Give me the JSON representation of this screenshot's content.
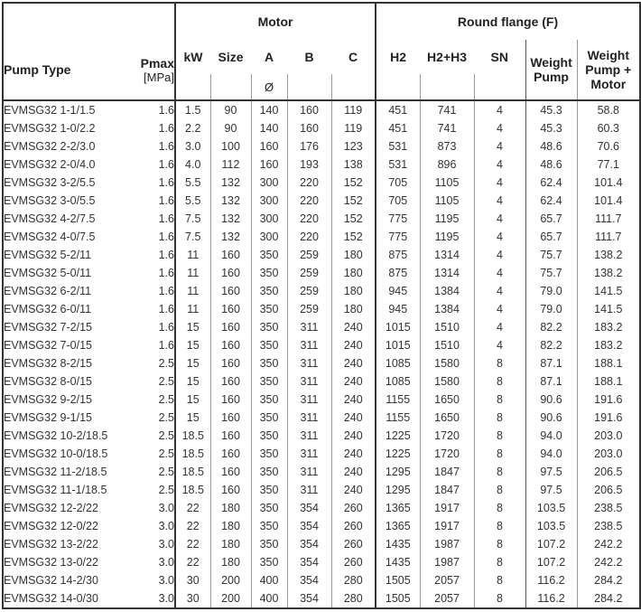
{
  "header": {
    "pump_type": "Pump Type",
    "pmax": "Pmax",
    "pmax_unit": "[MPa]",
    "motor_group": "Motor",
    "flange_group": "Round flange (F)",
    "kw": "kW",
    "size": "Size",
    "a": "A",
    "a_unit": "Ø",
    "b": "B",
    "c": "C",
    "h2": "H2",
    "h2h3": "H2+H3",
    "sn": "SN",
    "weight_pump_l1": "Weight",
    "weight_pump_l2": "Pump",
    "weight_total_l1": "Weight",
    "weight_total_l2": "Pump +",
    "weight_total_l3": "Motor"
  },
  "rows": [
    [
      "EVMSG32 1-1/1.5",
      "1.6",
      "1.5",
      "90",
      "140",
      "160",
      "119",
      "451",
      "741",
      "4",
      "45.3",
      "58.8"
    ],
    [
      "EVMSG32 1-0/2.2",
      "1.6",
      "2.2",
      "90",
      "140",
      "160",
      "119",
      "451",
      "741",
      "4",
      "45.3",
      "60.3"
    ],
    [
      "EVMSG32 2-2/3.0",
      "1.6",
      "3.0",
      "100",
      "160",
      "176",
      "123",
      "531",
      "873",
      "4",
      "48.6",
      "70.6"
    ],
    [
      "EVMSG32 2-0/4.0",
      "1.6",
      "4.0",
      "112",
      "160",
      "193",
      "138",
      "531",
      "896",
      "4",
      "48.6",
      "77.1"
    ],
    [
      "EVMSG32 3-2/5.5",
      "1.6",
      "5.5",
      "132",
      "300",
      "220",
      "152",
      "705",
      "1105",
      "4",
      "62.4",
      "101.4"
    ],
    [
      "EVMSG32 3-0/5.5",
      "1.6",
      "5.5",
      "132",
      "300",
      "220",
      "152",
      "705",
      "1105",
      "4",
      "62.4",
      "101.4"
    ],
    [
      "EVMSG32 4-2/7.5",
      "1.6",
      "7.5",
      "132",
      "300",
      "220",
      "152",
      "775",
      "1195",
      "4",
      "65.7",
      "111.7"
    ],
    [
      "EVMSG32 4-0/7.5",
      "1.6",
      "7.5",
      "132",
      "300",
      "220",
      "152",
      "775",
      "1195",
      "4",
      "65.7",
      "111.7"
    ],
    [
      "EVMSG32 5-2/11",
      "1.6",
      "11",
      "160",
      "350",
      "259",
      "180",
      "875",
      "1314",
      "4",
      "75.7",
      "138.2"
    ],
    [
      "EVMSG32 5-0/11",
      "1.6",
      "11",
      "160",
      "350",
      "259",
      "180",
      "875",
      "1314",
      "4",
      "75.7",
      "138.2"
    ],
    [
      "EVMSG32 6-2/11",
      "1.6",
      "11",
      "160",
      "350",
      "259",
      "180",
      "945",
      "1384",
      "4",
      "79.0",
      "141.5"
    ],
    [
      "EVMSG32 6-0/11",
      "1.6",
      "11",
      "160",
      "350",
      "259",
      "180",
      "945",
      "1384",
      "4",
      "79.0",
      "141.5"
    ],
    [
      "EVMSG32 7-2/15",
      "1.6",
      "15",
      "160",
      "350",
      "311",
      "240",
      "1015",
      "1510",
      "4",
      "82.2",
      "183.2"
    ],
    [
      "EVMSG32 7-0/15",
      "1.6",
      "15",
      "160",
      "350",
      "311",
      "240",
      "1015",
      "1510",
      "4",
      "82.2",
      "183.2"
    ],
    [
      "EVMSG32 8-2/15",
      "2.5",
      "15",
      "160",
      "350",
      "311",
      "240",
      "1085",
      "1580",
      "8",
      "87.1",
      "188.1"
    ],
    [
      "EVMSG32 8-0/15",
      "2.5",
      "15",
      "160",
      "350",
      "311",
      "240",
      "1085",
      "1580",
      "8",
      "87.1",
      "188.1"
    ],
    [
      "EVMSG32 9-2/15",
      "2.5",
      "15",
      "160",
      "350",
      "311",
      "240",
      "1155",
      "1650",
      "8",
      "90.6",
      "191.6"
    ],
    [
      "EVMSG32 9-1/15",
      "2.5",
      "15",
      "160",
      "350",
      "311",
      "240",
      "1155",
      "1650",
      "8",
      "90.6",
      "191.6"
    ],
    [
      "EVMSG32 10-2/18.5",
      "2.5",
      "18.5",
      "160",
      "350",
      "311",
      "240",
      "1225",
      "1720",
      "8",
      "94.0",
      "203.0"
    ],
    [
      "EVMSG32 10-0/18.5",
      "2.5",
      "18.5",
      "160",
      "350",
      "311",
      "240",
      "1225",
      "1720",
      "8",
      "94.0",
      "203.0"
    ],
    [
      "EVMSG32 11-2/18.5",
      "2.5",
      "18.5",
      "160",
      "350",
      "311",
      "240",
      "1295",
      "1847",
      "8",
      "97.5",
      "206.5"
    ],
    [
      "EVMSG32 11-1/18.5",
      "2.5",
      "18.5",
      "160",
      "350",
      "311",
      "240",
      "1295",
      "1847",
      "8",
      "97.5",
      "206.5"
    ],
    [
      "EVMSG32 12-2/22",
      "3.0",
      "22",
      "180",
      "350",
      "354",
      "260",
      "1365",
      "1917",
      "8",
      "103.5",
      "238.5"
    ],
    [
      "EVMSG32 12-0/22",
      "3.0",
      "22",
      "180",
      "350",
      "354",
      "260",
      "1365",
      "1917",
      "8",
      "103.5",
      "238.5"
    ],
    [
      "EVMSG32 13-2/22",
      "3.0",
      "22",
      "180",
      "350",
      "354",
      "260",
      "1435",
      "1987",
      "8",
      "107.2",
      "242.2"
    ],
    [
      "EVMSG32 13-0/22",
      "3.0",
      "22",
      "180",
      "350",
      "354",
      "260",
      "1435",
      "1987",
      "8",
      "107.2",
      "242.2"
    ],
    [
      "EVMSG32 14-2/30",
      "3.0",
      "30",
      "200",
      "400",
      "354",
      "280",
      "1505",
      "2057",
      "8",
      "116.2",
      "284.2"
    ],
    [
      "EVMSG32 14-0/30",
      "3.0",
      "30",
      "200",
      "400",
      "354",
      "280",
      "1505",
      "2057",
      "8",
      "116.2",
      "284.2"
    ]
  ]
}
